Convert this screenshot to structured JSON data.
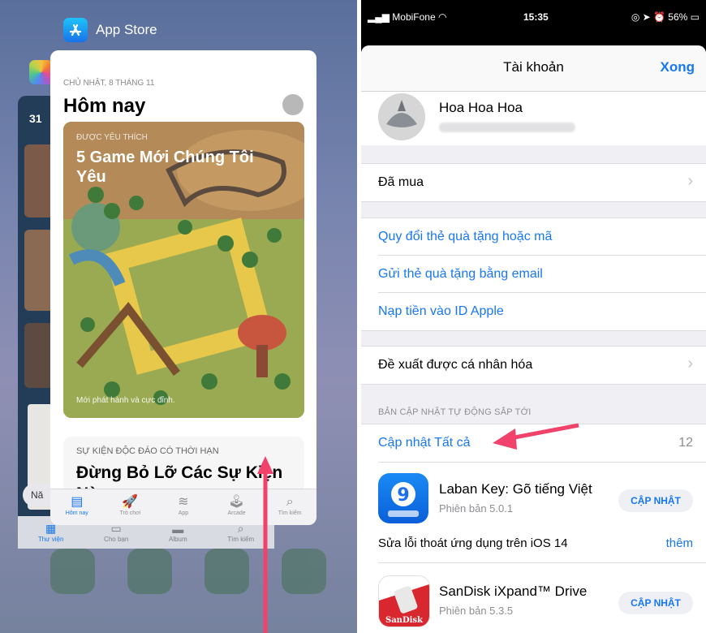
{
  "left": {
    "app_label": "App Store",
    "bg_card_number": "31",
    "date": "CHỦ NHẬT, 8 THÁNG 11",
    "today": "Hôm nay",
    "hero": {
      "kicker": "ĐƯỢC YÊU THÍCH",
      "title": "5 Game Mới Chúng Tôi Yêu",
      "subtitle": "Mới phát hành và cực đỉnh."
    },
    "next": {
      "kicker": "SỰ KIỆN ĐỘC ĐÁO CÓ THỜI HẠN",
      "title": "Đừng Bỏ Lỡ Các Sự Kiện Này"
    },
    "tabs": [
      {
        "label": "Hôm nay",
        "icon": "today-icon",
        "glyph": "▤"
      },
      {
        "label": "Trò chơi",
        "icon": "rocket-icon",
        "glyph": "🚀"
      },
      {
        "label": "App",
        "icon": "stack-icon",
        "glyph": "≋"
      },
      {
        "label": "Arcade",
        "icon": "joystick-icon",
        "glyph": "🕹"
      },
      {
        "label": "Tìm kiếm",
        "icon": "search-icon",
        "glyph": "⌕"
      }
    ],
    "bottom_strip": [
      "Thư viện",
      "Cho bạn",
      "Album",
      "Tìm kiếm"
    ],
    "bg_search_stub": "Nă"
  },
  "right": {
    "status": {
      "carrier": "MobiFone",
      "time": "15:35",
      "battery": "56%"
    },
    "nav": {
      "title": "Tài khoản",
      "done": "Xong"
    },
    "profile": {
      "name": "Hoa Hoa Hoa"
    },
    "purchased": "Đã mua",
    "links": [
      "Quy đổi thẻ quà tặng hoặc mã",
      "Gửi thẻ quà tặng bằng email",
      "Nạp tiền vào ID Apple"
    ],
    "personalized": "Đề xuất được cá nhân hóa",
    "updates_header": "BẢN CẬP NHẬT TỰ ĐỘNG SẮP TỚI",
    "update_all": "Cập nhật Tất cả",
    "update_count": "12",
    "apps": [
      {
        "name": "Laban Key: Gõ tiếng Việt",
        "version": "Phiên bản 5.0.1",
        "button": "CẬP NHẬT",
        "notes": "Sửa lỗi thoát ứng dụng trên iOS 14",
        "more": "thêm"
      },
      {
        "name": "SanDisk iXpand™ Drive",
        "version": "Phiên bản 5.3.5",
        "button": "CẬP NHẬT",
        "icon_text": "SanDisk"
      }
    ]
  },
  "colors": {
    "accent": "#1877f2",
    "arrow": "#f0426a"
  }
}
